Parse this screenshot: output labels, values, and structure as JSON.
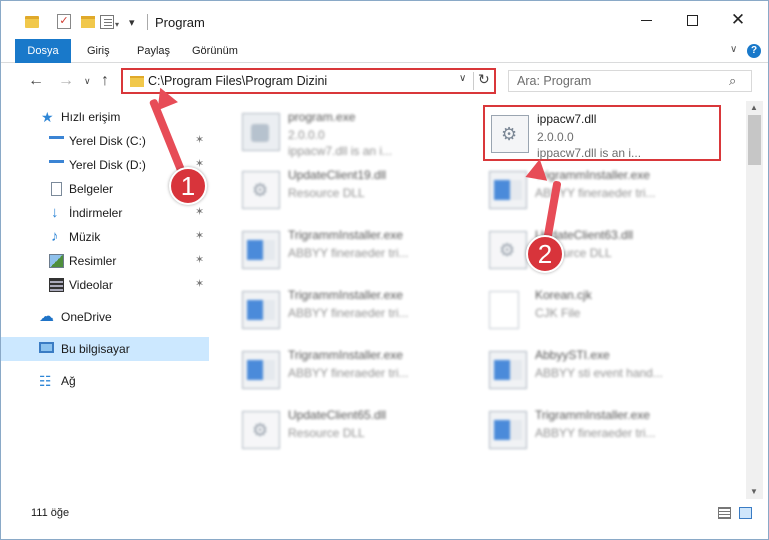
{
  "window": {
    "title": "Program",
    "quick_access": {
      "customize_glyph": "▾",
      "dropdown_glyph": "▾"
    },
    "controls": {
      "close_glyph": "✕"
    }
  },
  "ribbon": {
    "tabs": [
      {
        "label": "Dosya",
        "active": true
      },
      {
        "label": "Giriş"
      },
      {
        "label": "Paylaş"
      },
      {
        "label": "Görünüm"
      }
    ],
    "expand_glyph": "∨",
    "help_glyph": "?"
  },
  "nav": {
    "back_glyph": "←",
    "forward_glyph": "→",
    "recent_glyph": "∨",
    "up_glyph": "↑",
    "address": "C:\\Program Files\\Program Dizini",
    "address_dd_glyph": "∨",
    "refresh_glyph": "↻",
    "search_placeholder": "Ara: Program",
    "search_glyph": "⌕"
  },
  "sidebar": {
    "items": [
      {
        "label": "Hızlı erişim",
        "icon": "quick-access-icon",
        "glyph": "★"
      },
      {
        "label": "Yerel Disk (C:)",
        "icon": "drive-icon",
        "pinned": true
      },
      {
        "label": "Yerel Disk (D:)",
        "icon": "drive-icon",
        "pinned": true
      },
      {
        "label": "Belgeler",
        "icon": "documents-icon",
        "pinned": true
      },
      {
        "label": "İndirmeler",
        "icon": "downloads-icon",
        "glyph": "↓",
        "pinned": true
      },
      {
        "label": "Müzik",
        "icon": "music-icon",
        "glyph": "♪",
        "pinned": true
      },
      {
        "label": "Resimler",
        "icon": "pictures-icon",
        "pinned": true
      },
      {
        "label": "Videolar",
        "icon": "videos-icon",
        "pinned": true
      },
      {
        "label": "OneDrive",
        "icon": "onedrive-icon",
        "glyph": "☁"
      },
      {
        "label": "Bu bilgisayar",
        "icon": "this-pc-icon",
        "selected": true
      },
      {
        "label": "Ağ",
        "icon": "network-icon",
        "glyph": "☷"
      }
    ],
    "pin_glyph": "✶"
  },
  "files": [
    {
      "name": "program.exe",
      "line2": "2.0.0.0",
      "line3": "ippacw7.dll is an i...",
      "icon": "program-icon",
      "blurred": true
    },
    {
      "name": "ippacw7.dll",
      "line2": "2.0.0.0",
      "line3": "ippacw7.dll is an i...",
      "icon": "dll-file-icon",
      "selected": true
    },
    {
      "name": "UpdateClient19.dll",
      "line2": "Resource DLL",
      "line3": "",
      "icon": "dll-file-icon",
      "blurred": true
    },
    {
      "name": "TrigrammInstaller.exe",
      "line2": "ABBYY fineraeder tri...",
      "line3": "",
      "icon": "exe-file-icon",
      "blurred": true
    },
    {
      "name": "TrigrammInstaller.exe",
      "line2": "ABBYY fineraeder tri...",
      "line3": "",
      "icon": "exe-file-icon",
      "blurred": true
    },
    {
      "name": "UpdateClient63.dll",
      "line2": "Resource DLL",
      "line3": "",
      "icon": "dll-file-icon",
      "blurred": true
    },
    {
      "name": "TrigrammInstaller.exe",
      "line2": "ABBYY fineraeder tri...",
      "line3": "",
      "icon": "exe-file-icon",
      "blurred": true
    },
    {
      "name": "Korean.cjk",
      "line2": "CJK File",
      "line3": "",
      "icon": "text-file-icon",
      "blurred": true
    },
    {
      "name": "TrigrammInstaller.exe",
      "line2": "ABBYY fineraeder tri...",
      "line3": "",
      "icon": "exe-file-icon",
      "blurred": true
    },
    {
      "name": "AbbyySTI.exe",
      "line2": "ABBYY sti event hand...",
      "line3": "",
      "icon": "exe-file-icon",
      "blurred": true
    },
    {
      "name": "UpdateClient65.dll",
      "line2": "Resource DLL",
      "line3": "",
      "icon": "dll-file-icon",
      "blurred": true
    },
    {
      "name": "TrigrammInstaller.exe",
      "line2": "ABBYY fineraeder tri...",
      "line3": "",
      "icon": "exe-file-icon",
      "blurred": true
    }
  ],
  "scrollbar": {
    "up_glyph": "▲",
    "down_glyph": "▼"
  },
  "status": {
    "item_count": "111 öğe"
  },
  "annotations": [
    {
      "number": "1",
      "color": "#d8343b"
    },
    {
      "number": "2",
      "color": "#d8343b"
    }
  ]
}
